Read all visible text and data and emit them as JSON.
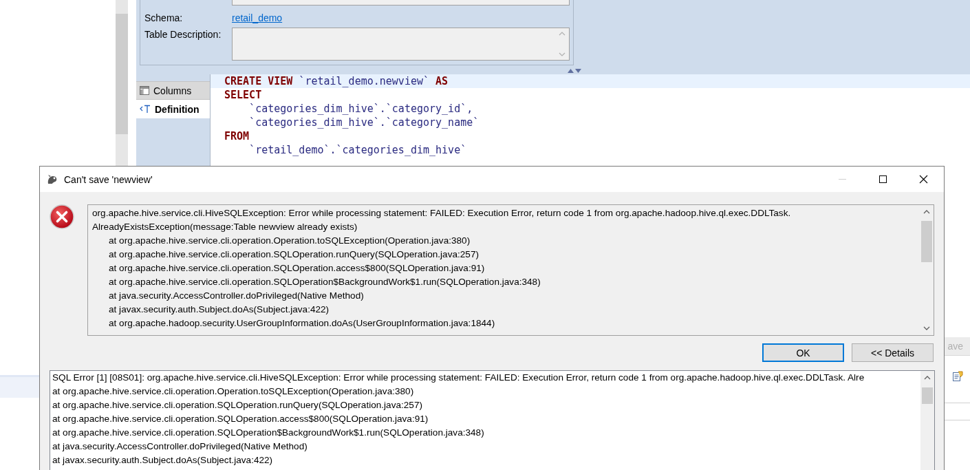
{
  "editor": {
    "fields": [
      {
        "label": "Schema:",
        "value": "retail_demo",
        "kind": "link"
      },
      {
        "label": "Table Description:",
        "kind": "textarea"
      }
    ],
    "tabs": [
      {
        "label": "Columns",
        "selected": false,
        "kind": "columns"
      },
      {
        "label": "Definition",
        "selected": true,
        "kind": "definition"
      }
    ],
    "code_lines": [
      {
        "text": "**CREATE VIEW** `retail_demo.newview` **AS**",
        "current": true
      },
      {
        "text": "**SELECT**",
        "current": false
      },
      {
        "text": "    `categories_dim_hive`.`category_id`,",
        "current": false
      },
      {
        "text": "    `categories_dim_hive`.`category_name`",
        "current": false
      },
      {
        "text": "**FROM**",
        "current": false
      },
      {
        "text": "    `retail_demo`.`categories_dim_hive`",
        "current": false
      }
    ],
    "toolbar": {
      "label": "ave",
      "disabled": true
    }
  },
  "dialog": {
    "title": "Can't save 'newview'",
    "message": [
      {
        "text": "org.apache.hive.service.cli.HiveSQLException: Error while processing statement: FAILED: Execution Error, return code 1 from org.apache.hadoop.hive.ql.exec.DDLTask.",
        "indented": false
      },
      {
        "text": "AlreadyExistsException(message:Table newview already exists)",
        "indented": false
      },
      {
        "text": "at org.apache.hive.service.cli.operation.Operation.toSQLException(Operation.java:380)",
        "indented": true
      },
      {
        "text": "at org.apache.hive.service.cli.operation.SQLOperation.runQuery(SQLOperation.java:257)",
        "indented": true
      },
      {
        "text": "at org.apache.hive.service.cli.operation.SQLOperation.access$800(SQLOperation.java:91)",
        "indented": true
      },
      {
        "text": "at org.apache.hive.service.cli.operation.SQLOperation$BackgroundWork$1.run(SQLOperation.java:348)",
        "indented": true
      },
      {
        "text": "at java.security.AccessController.doPrivileged(Native Method)",
        "indented": true
      },
      {
        "text": "at javax.security.auth.Subject.doAs(Subject.java:422)",
        "indented": true
      },
      {
        "text": "at org.apache.hadoop.security.UserGroupInformation.doAs(UserGroupInformation.java:1844)",
        "indented": true
      }
    ],
    "buttons": [
      {
        "label": "OK",
        "default": true
      },
      {
        "label": "<< Details",
        "default": false
      }
    ],
    "details": [
      "SQL Error [1] [08S01]: org.apache.hive.service.cli.HiveSQLException: Error while processing statement: FAILED: Execution Error, return code 1 from org.apache.hadoop.hive.ql.exec.DDLTask. Alre",
      "at org.apache.hive.service.cli.operation.Operation.toSQLException(Operation.java:380)",
      "at org.apache.hive.service.cli.operation.SQLOperation.runQuery(SQLOperation.java:257)",
      "at org.apache.hive.service.cli.operation.SQLOperation.access$800(SQLOperation.java:91)",
      "at org.apache.hive.service.cli.operation.SQLOperation$BackgroundWork$1.run(SQLOperation.java:348)",
      "at java.security.AccessController.doPrivileged(Native Method)",
      "at javax.security.auth.Subject.doAs(Subject.java:422)"
    ]
  }
}
